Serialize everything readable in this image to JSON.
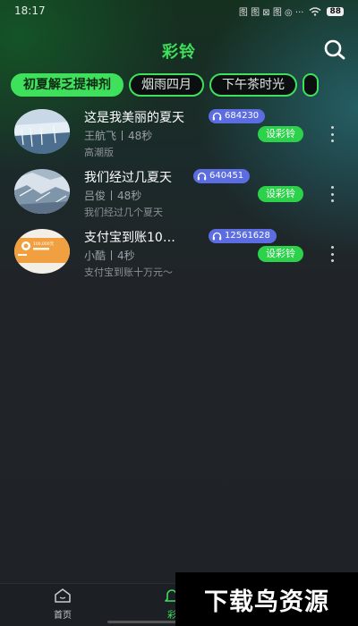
{
  "status_bar": {
    "time": "18:17",
    "icons_text": "图 图 ⊠ 图 ◎ ···",
    "battery": "88"
  },
  "header": {
    "title": "彩铃",
    "search_icon": "search-icon"
  },
  "categories": [
    {
      "label": "初夏解乏提神剂",
      "active": true
    },
    {
      "label": "烟雨四月",
      "active": false
    },
    {
      "label": "下午茶时光",
      "active": false
    }
  ],
  "ringtones": [
    {
      "title": "这是我美丽的夏天",
      "play_count": "684230",
      "artist": "王航飞",
      "duration": "48秒",
      "description": "高潮版",
      "action_label": "设彩铃"
    },
    {
      "title": "我们经过几夏天",
      "play_count": "640451",
      "artist": "吕俊",
      "duration": "48秒",
      "description": "我们经过几个夏天",
      "action_label": "设彩铃"
    },
    {
      "title": "支付宝到账10…",
      "play_count": "12561628",
      "artist": "小酷",
      "duration": "4秒",
      "description": "支付宝到账十万元～",
      "action_label": "设彩铃",
      "thumb_text": "100,000元"
    }
  ],
  "bottom_nav": [
    {
      "label": "首页",
      "icon": "home-icon",
      "active": false
    },
    {
      "label": "彩",
      "icon": "bell-icon",
      "active": true
    }
  ],
  "watermark": "下载鸟资源",
  "colors": {
    "accent": "#3ee05c",
    "badge": "#5b6de0",
    "button": "#2bd24a"
  }
}
